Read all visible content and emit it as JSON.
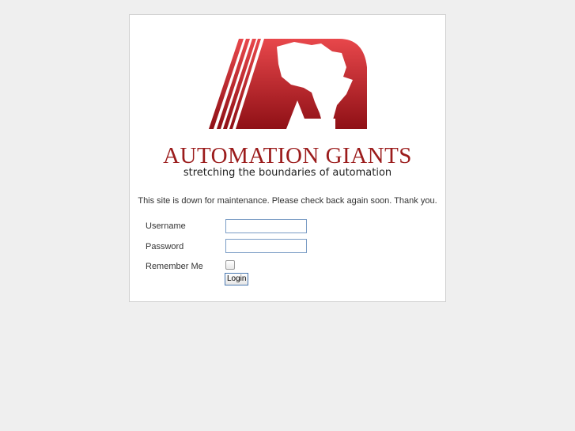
{
  "brand": {
    "title": "AUTOMATION GIANTS",
    "tagline": "stretching the boundaries of automation",
    "logo_icon": "africa-a-logo",
    "primary_color": "#9b1c1c",
    "accent_color": "#d83a3a"
  },
  "message": "This site is down for maintenance. Please check back again soon. Thank you.",
  "form": {
    "username_label": "Username",
    "username_value": "",
    "password_label": "Password",
    "password_value": "",
    "remember_label": "Remember Me",
    "remember_checked": false,
    "login_label": "Login"
  }
}
